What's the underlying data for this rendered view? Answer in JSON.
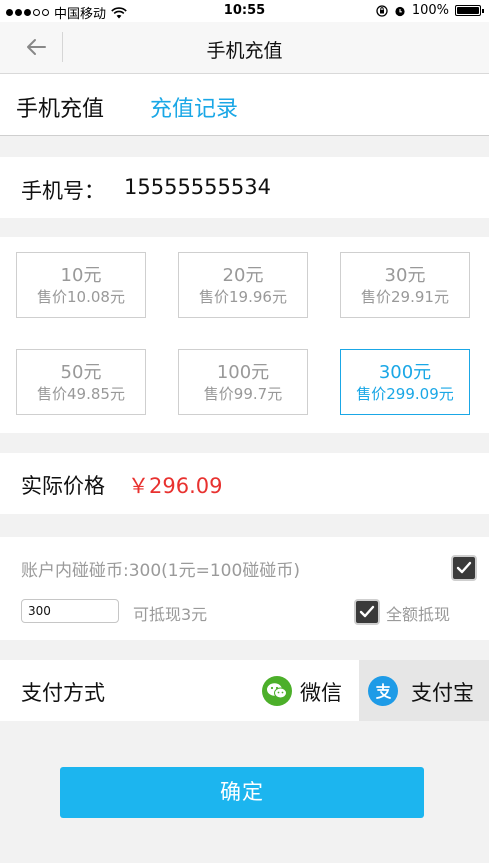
{
  "status_bar": {
    "carrier": "中国移动",
    "time": "10:55",
    "battery": "100%",
    "battery_level": 1.0
  },
  "nav": {
    "title": "手机充值"
  },
  "tabs": [
    {
      "label": "手机充值",
      "active": true
    },
    {
      "label": "充值记录",
      "active": false
    }
  ],
  "phone": {
    "label": "手机号：",
    "value": "15555555534"
  },
  "options": [
    {
      "amount": "10元",
      "price": "售价10.08元",
      "selected": false
    },
    {
      "amount": "20元",
      "price": "售价19.96元",
      "selected": false
    },
    {
      "amount": "30元",
      "price": "售价29.91元",
      "selected": false
    },
    {
      "amount": "50元",
      "price": "售价49.85元",
      "selected": false
    },
    {
      "amount": "100元",
      "price": "售价99.7元",
      "selected": false
    },
    {
      "amount": "300元",
      "price": "售价299.09元",
      "selected": true
    }
  ],
  "actual_price": {
    "label": "实际价格",
    "value": "￥296.09"
  },
  "coins": {
    "description": "账户内碰碰币:300(1元=100碰碰币)",
    "use_checked": true,
    "input_value": "300",
    "offset_text": "可抵现3元",
    "full_offset_label": "全额抵现",
    "full_offset_checked": true
  },
  "payment": {
    "label": "支付方式",
    "methods": [
      {
        "name": "微信",
        "icon": "wechat-icon",
        "selected": false
      },
      {
        "name": "支付宝",
        "icon": "alipay-icon",
        "selected": true
      }
    ]
  },
  "confirm_label": "确定",
  "colors": {
    "accent": "#1aa7e6",
    "price_red": "#e8312f",
    "button_blue": "#1cb5ef",
    "wechat_green": "#4caf2a",
    "alipay_blue": "#1e9be7"
  }
}
